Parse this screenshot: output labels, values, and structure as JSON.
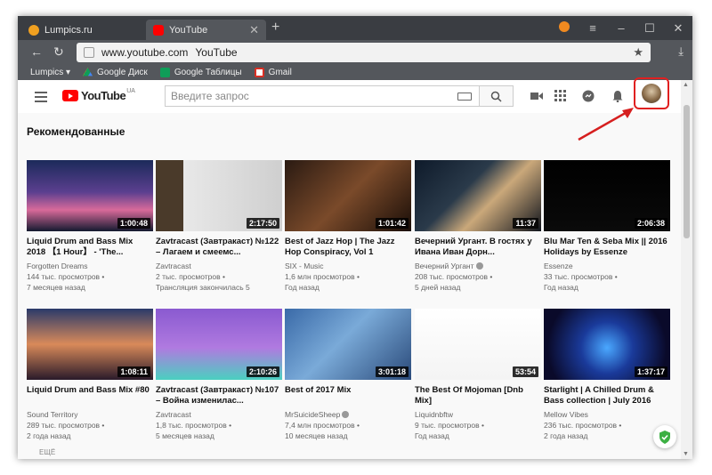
{
  "browser": {
    "tabs": [
      {
        "label": "Lumpics.ru",
        "active": false,
        "favicon_color": "#f0a020"
      },
      {
        "label": "YouTube",
        "active": true,
        "favicon_color": "#ff0000"
      }
    ],
    "url": "www.youtube.com",
    "page_title": "YouTube",
    "bookmarks": [
      {
        "label": "Lumpics ▾",
        "icon": "lumpics-icon",
        "color": ""
      },
      {
        "label": "Google Диск",
        "icon": "google-drive-icon",
        "color": "#f4b400"
      },
      {
        "label": "Google Таблицы",
        "icon": "google-sheets-icon",
        "color": "#0f9d58"
      },
      {
        "label": "Gmail",
        "icon": "gmail-icon",
        "color": "#d93025"
      }
    ]
  },
  "youtube": {
    "logo_text": "YouTube",
    "logo_region": "UA",
    "search_placeholder": "Введите запрос",
    "section_title": "Рекомендованные",
    "more_label": "ЕЩЁ",
    "videos": [
      {
        "title": "Liquid Drum and Bass Mix 2018 【1 Hour】 - 'The...",
        "channel": "Forgotten Dreams",
        "views": "144 тыс. просмотров •",
        "age": "7 месяцев назад",
        "duration": "1:00:48",
        "verified": false,
        "thumb": "linear-gradient(180deg,#1b2a5a 0%,#5b3f8f 45%,#d86a9a 70%,#141a30 100%)"
      },
      {
        "title": "Zavtracast (Завтракаст) №122 – Лагаем и смеемс...",
        "channel": "Zavtracast",
        "views": "2 тыс. просмотров •",
        "age": "Трансляция закончилась 5",
        "duration": "2:17:50",
        "verified": false,
        "thumb": "linear-gradient(90deg,#4a3a2a 0%,#4a3a2a 22%,#e8e8e8 22%,#cfcfcf 100%)"
      },
      {
        "title": "Best of Jazz Hop | The Jazz Hop Conspiracy, Vol 1",
        "channel": "SIX - Music",
        "views": "1,6 млн просмотров •",
        "age": "Год назад",
        "duration": "1:01:42",
        "verified": false,
        "thumb": "linear-gradient(135deg,#2a1a12 0%,#7a4a2a 50%,#1a0e08 100%)"
      },
      {
        "title": "Вечерний Ургант. В гостях у Ивана Иван Дорн...",
        "channel": "Вечерний Ургант",
        "views": "208 тыс. просмотров •",
        "age": "5 дней назад",
        "duration": "11:37",
        "verified": true,
        "thumb": "linear-gradient(135deg,#0e1a2a 0%,#2a3a4a 40%,#caa87a 60%,#10141c 100%)"
      },
      {
        "title": "Blu Mar Ten & Seba Mix || 2016 Holidays by Essenze",
        "channel": "Essenze",
        "views": "33 тыс. просмотров •",
        "age": "Год назад",
        "duration": "2:06:38",
        "verified": false,
        "thumb": "linear-gradient(180deg,#000000 0%,#0a0a0a 100%)"
      },
      {
        "title": "Liquid Drum and Bass Mix #80",
        "channel": "Sound Territory",
        "views": "289 тыс. просмотров •",
        "age": "2 года назад",
        "duration": "1:08:11",
        "verified": false,
        "thumb": "linear-gradient(180deg,#2a3a6a 0%,#d98a5a 50%,#2a1a2a 100%)"
      },
      {
        "title": "Zavtracast (Завтракаст) №107 – Война изменилас...",
        "channel": "Zavtracast",
        "views": "1,8 тыс. просмотров •",
        "age": "5 месяцев назад",
        "duration": "2:10:26",
        "verified": false,
        "thumb": "linear-gradient(180deg,#8a5ad0 0%,#b07ae0 55%,#4ad0c0 100%)"
      },
      {
        "title": "Best of 2017 Mix",
        "channel": "MrSuicideSheep",
        "views": "7,4 млн просмотров •",
        "age": "10 месяцев назад",
        "duration": "3:01:18",
        "verified": true,
        "thumb": "linear-gradient(135deg,#3a6aa8 0%,#7aaad8 45%,#2a4a7a 100%)"
      },
      {
        "title": "The Best Of Mojoman [Dnb Mix]",
        "channel": "Liquidnbftw",
        "views": "9 тыс. просмотров •",
        "age": "Год назад",
        "duration": "53:54",
        "verified": false,
        "thumb": "linear-gradient(180deg,#ffffff 0%,#f4f4f4 100%)"
      },
      {
        "title": "Starlight | A Chilled Drum & Bass collection | July 2016",
        "channel": "Mellow Vibes",
        "views": "236 тыс. просмотров •",
        "age": "2 года назад",
        "duration": "1:37:17",
        "verified": false,
        "thumb": "radial-gradient(circle at 50% 55%,#4aa8ff 0%,#1a3a9a 35%,#0a0a2a 80%)"
      }
    ]
  }
}
